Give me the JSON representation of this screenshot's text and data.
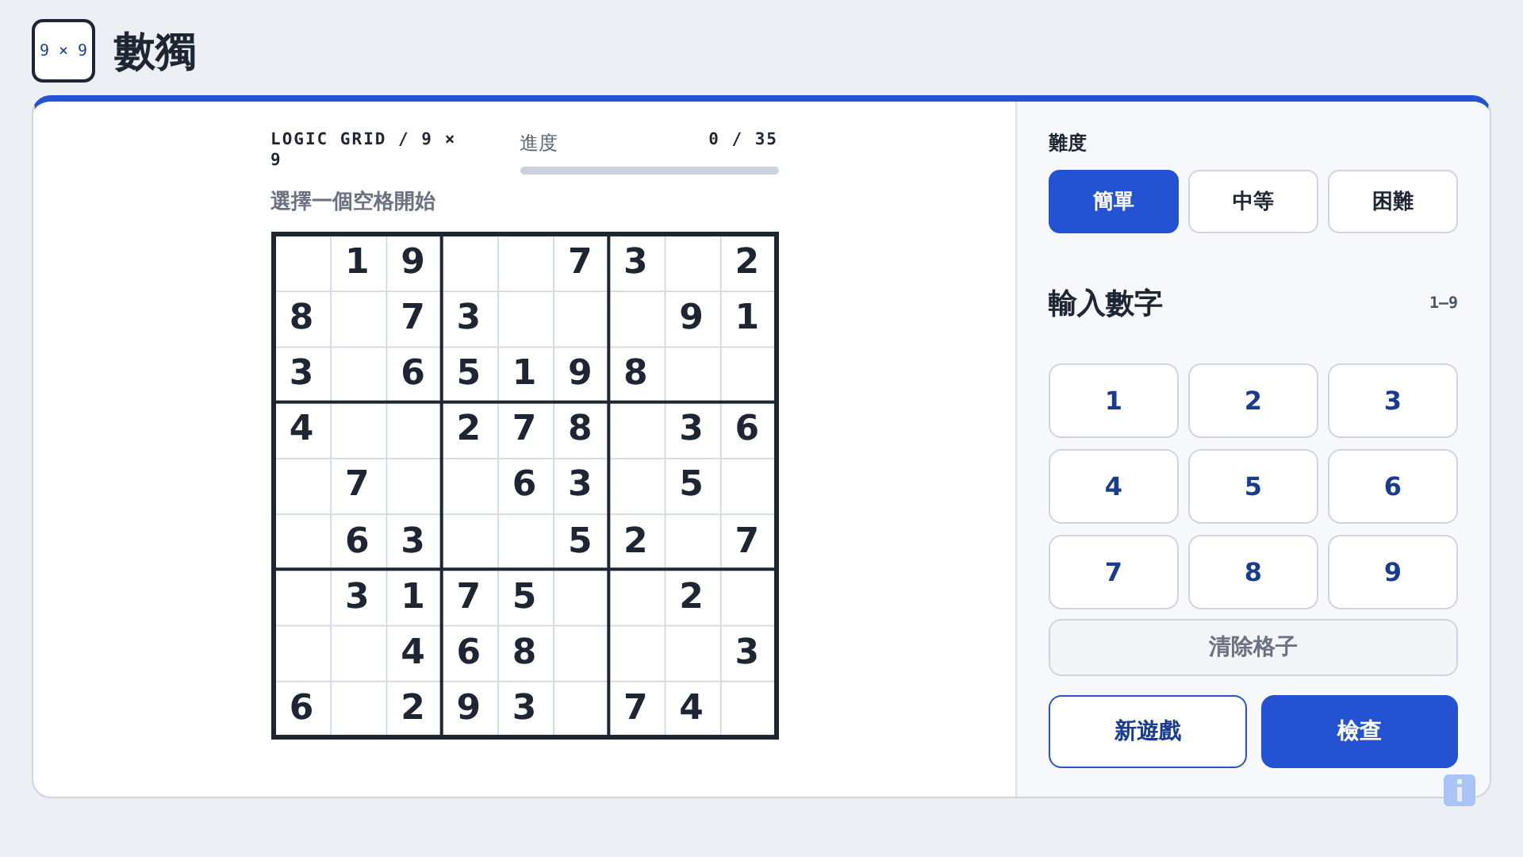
{
  "header": {
    "logo": "9 × 9",
    "title": "數獨"
  },
  "board": {
    "caption": "LOGIC GRID / 9 × 9",
    "progress": {
      "label": "進度",
      "reading": "0 / 35",
      "level": 0
    },
    "hint": "選擇一個空格開始",
    "rows": [
      [
        {
          "kind": "empty"
        },
        {
          "kind": "given",
          "value": "1"
        },
        {
          "kind": "given",
          "value": "9"
        },
        {
          "kind": "empty"
        },
        {
          "kind": "empty"
        },
        {
          "kind": "given",
          "value": "7"
        },
        {
          "kind": "given",
          "value": "3"
        },
        {
          "kind": "empty"
        },
        {
          "kind": "given",
          "value": "2"
        }
      ],
      [
        {
          "kind": "given",
          "value": "8"
        },
        {
          "kind": "empty"
        },
        {
          "kind": "given",
          "value": "7"
        },
        {
          "kind": "given",
          "value": "3"
        },
        {
          "kind": "empty"
        },
        {
          "kind": "empty"
        },
        {
          "kind": "empty"
        },
        {
          "kind": "given",
          "value": "9"
        },
        {
          "kind": "given",
          "value": "1"
        }
      ],
      [
        {
          "kind": "given",
          "value": "3"
        },
        {
          "kind": "empty"
        },
        {
          "kind": "given",
          "value": "6"
        },
        {
          "kind": "given",
          "value": "5"
        },
        {
          "kind": "given",
          "value": "1"
        },
        {
          "kind": "given",
          "value": "9"
        },
        {
          "kind": "given",
          "value": "8"
        },
        {
          "kind": "empty"
        },
        {
          "kind": "empty"
        }
      ],
      [
        {
          "kind": "given",
          "value": "4"
        },
        {
          "kind": "empty"
        },
        {
          "kind": "empty"
        },
        {
          "kind": "given",
          "value": "2"
        },
        {
          "kind": "given",
          "value": "7"
        },
        {
          "kind": "given",
          "value": "8"
        },
        {
          "kind": "empty"
        },
        {
          "kind": "given",
          "value": "3"
        },
        {
          "kind": "given",
          "value": "6"
        }
      ],
      [
        {
          "kind": "empty"
        },
        {
          "kind": "given",
          "value": "7"
        },
        {
          "kind": "empty"
        },
        {
          "kind": "empty"
        },
        {
          "kind": "given",
          "value": "6"
        },
        {
          "kind": "given",
          "value": "3"
        },
        {
          "kind": "empty"
        },
        {
          "kind": "given",
          "value": "5"
        },
        {
          "kind": "empty"
        }
      ],
      [
        {
          "kind": "empty"
        },
        {
          "kind": "given",
          "value": "6"
        },
        {
          "kind": "given",
          "value": "3"
        },
        {
          "kind": "empty"
        },
        {
          "kind": "empty"
        },
        {
          "kind": "given",
          "value": "5"
        },
        {
          "kind": "given",
          "value": "2"
        },
        {
          "kind": "empty"
        },
        {
          "kind": "given",
          "value": "7"
        }
      ],
      [
        {
          "kind": "empty"
        },
        {
          "kind": "given",
          "value": "3"
        },
        {
          "kind": "given",
          "value": "1"
        },
        {
          "kind": "given",
          "value": "7"
        },
        {
          "kind": "given",
          "value": "5"
        },
        {
          "kind": "empty"
        },
        {
          "kind": "empty"
        },
        {
          "kind": "given",
          "value": "2"
        },
        {
          "kind": "empty"
        }
      ],
      [
        {
          "kind": "empty"
        },
        {
          "kind": "empty"
        },
        {
          "kind": "given",
          "value": "4"
        },
        {
          "kind": "given",
          "value": "6"
        },
        {
          "kind": "given",
          "value": "8"
        },
        {
          "kind": "empty"
        },
        {
          "kind": "empty"
        },
        {
          "kind": "empty"
        },
        {
          "kind": "given",
          "value": "3"
        }
      ],
      [
        {
          "kind": "given",
          "value": "6"
        },
        {
          "kind": "empty"
        },
        {
          "kind": "given",
          "value": "2"
        },
        {
          "kind": "given",
          "value": "9"
        },
        {
          "kind": "given",
          "value": "3"
        },
        {
          "kind": "empty"
        },
        {
          "kind": "given",
          "value": "7"
        },
        {
          "kind": "given",
          "value": "4"
        },
        {
          "kind": "empty"
        }
      ]
    ]
  },
  "sidebar": {
    "difficulty_label": "難度",
    "difficulties": [
      {
        "label": "簡單",
        "selected": true
      },
      {
        "label": "中等",
        "selected": false
      },
      {
        "label": "困難",
        "selected": false
      }
    ],
    "input_title": "輸入數字",
    "input_range": "1–9",
    "keys": [
      "1",
      "2",
      "3",
      "4",
      "5",
      "6",
      "7",
      "8",
      "9"
    ],
    "clear": "清除格子",
    "new_game": "新遊戲",
    "check": "檢查"
  }
}
